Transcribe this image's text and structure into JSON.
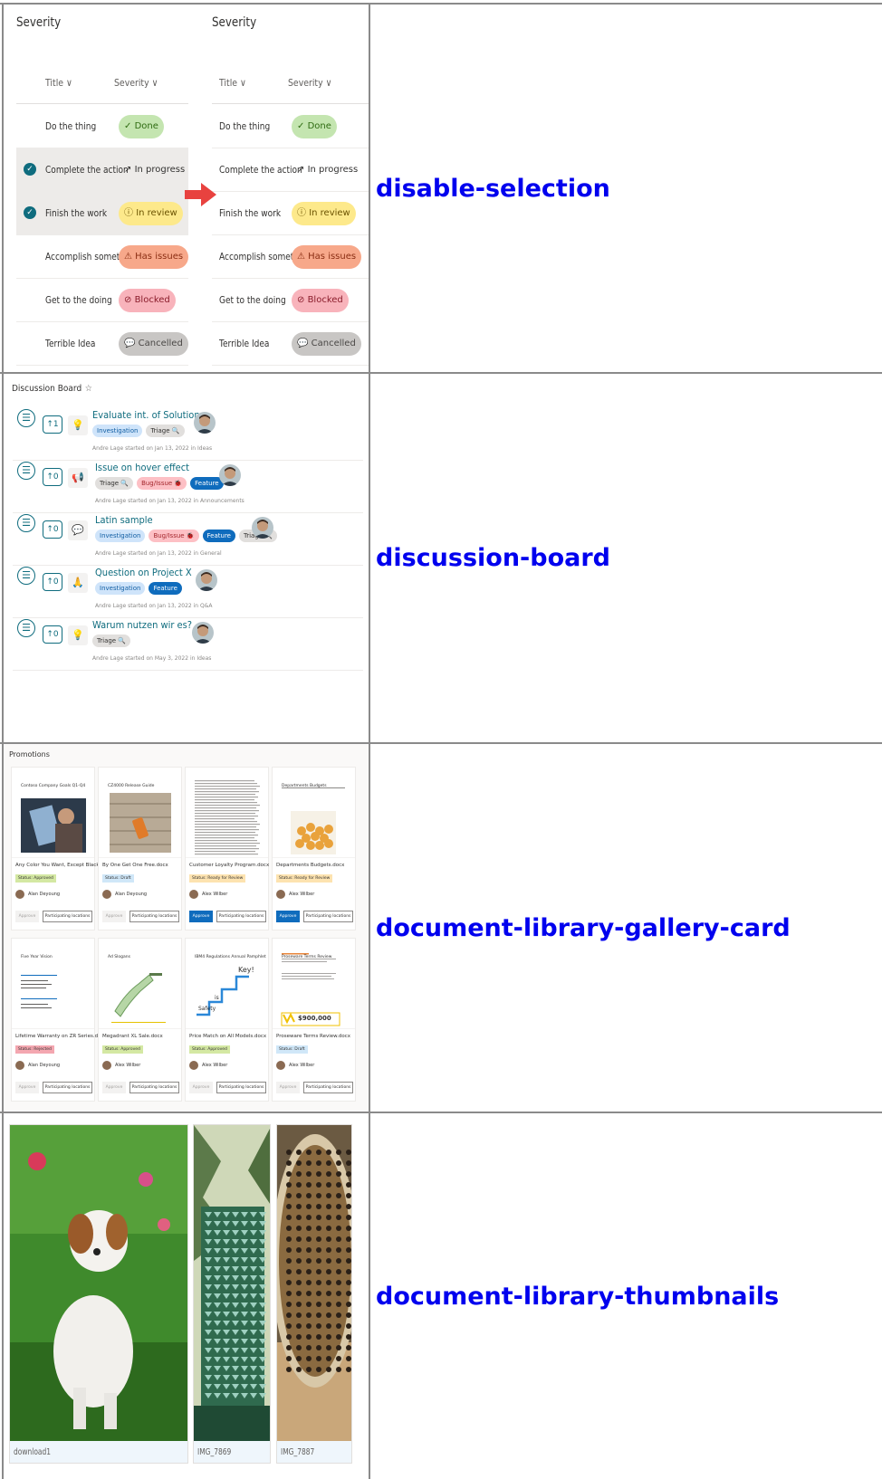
{
  "rows": [
    {
      "label": "disable-selection"
    },
    {
      "label": "discussion-board"
    },
    {
      "label": "document-library-gallery-card"
    },
    {
      "label": "document-library-thumbnails"
    }
  ],
  "severity": {
    "title": "Severity",
    "columns": {
      "title": "Title",
      "severity": "Severity"
    },
    "sort_glyph": "∨",
    "rows": [
      {
        "title": "Do the thing",
        "status": "Done",
        "icon": "✓",
        "color": "#c4e5b0",
        "text_color": "#2e6b11",
        "selected": false
      },
      {
        "title": "Complete the action",
        "status": "In progress",
        "icon": "↗",
        "color": "transparent",
        "text_color": "#323130",
        "selected": true
      },
      {
        "title": "Finish the work",
        "status": "In review",
        "icon": "ⓘ",
        "color": "#fde98b",
        "text_color": "#6b5300",
        "selected": true
      },
      {
        "title": "Accomplish something",
        "status": "Has issues",
        "icon": "⚠",
        "color": "#f7a88a",
        "text_color": "#8a2d12",
        "selected": false
      },
      {
        "title": "Get to the doing",
        "status": "Blocked",
        "icon": "⊘",
        "color": "#f8b3bb",
        "text_color": "#8a1c2b",
        "selected": false
      },
      {
        "title": "Terrible Idea",
        "status": "Cancelled",
        "icon": "💬",
        "color": "#c8c6c4",
        "text_color": "#4a4846",
        "selected": false
      }
    ],
    "check_glyph": "✓",
    "arrow_color": "#e8423f"
  },
  "board": {
    "title": "Discussion Board",
    "star": "☆",
    "menu_glyph": "☰",
    "items": [
      {
        "title": "Evaluate int. of Solution",
        "votes": "↑1",
        "cat_icon": "💡",
        "meta": "Andre Lage started on Jan 13, 2022 in Ideas",
        "tags": [
          {
            "text": "Investigation",
            "kind": "inv"
          },
          {
            "text": "Triage 🔍",
            "kind": "tri"
          }
        ]
      },
      {
        "title": "Issue on hover effect",
        "votes": "↑0",
        "cat_icon": "📢",
        "meta": "Andre Lage started on Jan 13, 2022 in Announcements",
        "tags": [
          {
            "text": "Triage 🔍",
            "kind": "tri"
          },
          {
            "text": "Bug/Issue 🐞",
            "kind": "bug"
          },
          {
            "text": "Feature",
            "kind": "feat"
          }
        ]
      },
      {
        "title": "Latin sample",
        "votes": "↑0",
        "cat_icon": "💬",
        "meta": "Andre Lage started on Jan 13, 2022 in General",
        "tags": [
          {
            "text": "Investigation",
            "kind": "inv"
          },
          {
            "text": "Bug/Issue 🐞",
            "kind": "bug"
          },
          {
            "text": "Feature",
            "kind": "feat"
          },
          {
            "text": "Triage 🔍",
            "kind": "tri"
          }
        ]
      },
      {
        "title": "Question on Project X",
        "votes": "↑0",
        "cat_icon": "🙏",
        "meta": "Andre Lage started on Jan 13, 2022 in Q&A",
        "tags": [
          {
            "text": "Investigation",
            "kind": "inv"
          },
          {
            "text": "Feature",
            "kind": "feat"
          }
        ]
      },
      {
        "title": "Warum nutzen wir es?",
        "votes": "↑0",
        "cat_icon": "💡",
        "meta": "Andre Lage started on May 3, 2022 in Ideas",
        "tags": [
          {
            "text": "Triage 🔍",
            "kind": "tri"
          }
        ]
      }
    ]
  },
  "gallery": {
    "title": "Promotions",
    "approve_label": "Approve",
    "locations_label": "Participating locations",
    "cards": [
      {
        "doc_title": "Contoso Company Goals Q1-Q4",
        "file": "Any Color You Want, Except Black.docx",
        "status": "Status: Approved",
        "status_bg": "#d4e8a3",
        "person": "Alan Deyoung",
        "approve_active": false,
        "thumb": "photo-tablet"
      },
      {
        "doc_title": "CZ4000 Release Guide",
        "file": "By One Get One Free.docx",
        "status": "Status: Draft",
        "status_bg": "#d0e7f8",
        "person": "Alan Deyoung",
        "approve_active": false,
        "thumb": "photo-phone"
      },
      {
        "doc_title": "",
        "file": "Customer Loyalty Program.docx",
        "status": "Status: Ready for Review",
        "status_bg": "#fde3b0",
        "person": "Alex Wilber",
        "approve_active": true,
        "thumb": "text-page"
      },
      {
        "doc_title": "Departments Budgets",
        "file": "Departments Budgets.docx",
        "status": "Status: Ready for Review",
        "status_bg": "#fde3b0",
        "person": "Alex Wilber",
        "approve_active": true,
        "thumb": "coins"
      },
      {
        "doc_title": "Five Year Vision",
        "file": "Lifetime Warranty on ZR Series.docx",
        "status": "Status: Rejected",
        "status_bg": "#f4a7b0",
        "person": "Alan Deyoung",
        "approve_active": false,
        "thumb": "outline"
      },
      {
        "doc_title": "Ad Slogans",
        "file": "Megadrant XL Sale.docx",
        "status": "Status: Approved",
        "status_bg": "#d4e8a3",
        "person": "Alex Wilber",
        "approve_active": false,
        "thumb": "sketch"
      },
      {
        "doc_title": "IBM4 Regulations Annual Pamphlet",
        "file": "Price Match on All Models.docx",
        "status": "Status: Approved",
        "status_bg": "#d4e8a3",
        "person": "Alex Wilber",
        "approve_active": false,
        "thumb": "stairs"
      },
      {
        "doc_title": "Proseware Terms Review",
        "file": "Proseware Terms Review.docx",
        "status": "Status: Draft",
        "status_bg": "#d0e7f8",
        "person": "Alex Wilber",
        "approve_active": false,
        "thumb": "money"
      }
    ],
    "stairs_labels": {
      "a": "Safety",
      "b": "is",
      "c": "Key!"
    },
    "money_label": "$900,000"
  },
  "thumbnails": {
    "items": [
      {
        "caption": "download1",
        "kind": "dog"
      },
      {
        "caption": "IMG_7869",
        "kind": "bag"
      },
      {
        "caption": "IMG_7887",
        "kind": "rug"
      }
    ]
  }
}
